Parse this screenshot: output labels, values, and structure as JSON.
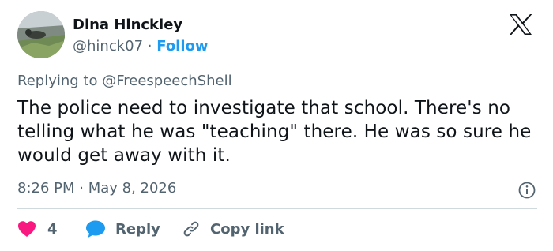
{
  "author": {
    "name": "Dina Hinckley",
    "handle": "@hinck07",
    "separator": "·",
    "follow_label": "Follow"
  },
  "reply_context": {
    "label": "Replying to @FreespeechShell"
  },
  "tweet": {
    "text": "The police need to investigate that school. There's no telling what he was \"teaching\" there. He was so sure he would get away with it.",
    "timestamp": "8:26 PM · May 8, 2026"
  },
  "actions": {
    "like_count": "4",
    "reply_label": "Reply",
    "copy_label": "Copy link"
  },
  "icons": {
    "logo": "x-logo-icon",
    "info": "info-icon",
    "like": "heart-icon",
    "reply": "speech-bubble-icon",
    "copy": "link-icon"
  },
  "colors": {
    "text_primary": "#0f1419",
    "text_secondary": "#536471",
    "accent": "#1d9bf0",
    "like": "#f91880",
    "divider": "#cfd9de"
  }
}
